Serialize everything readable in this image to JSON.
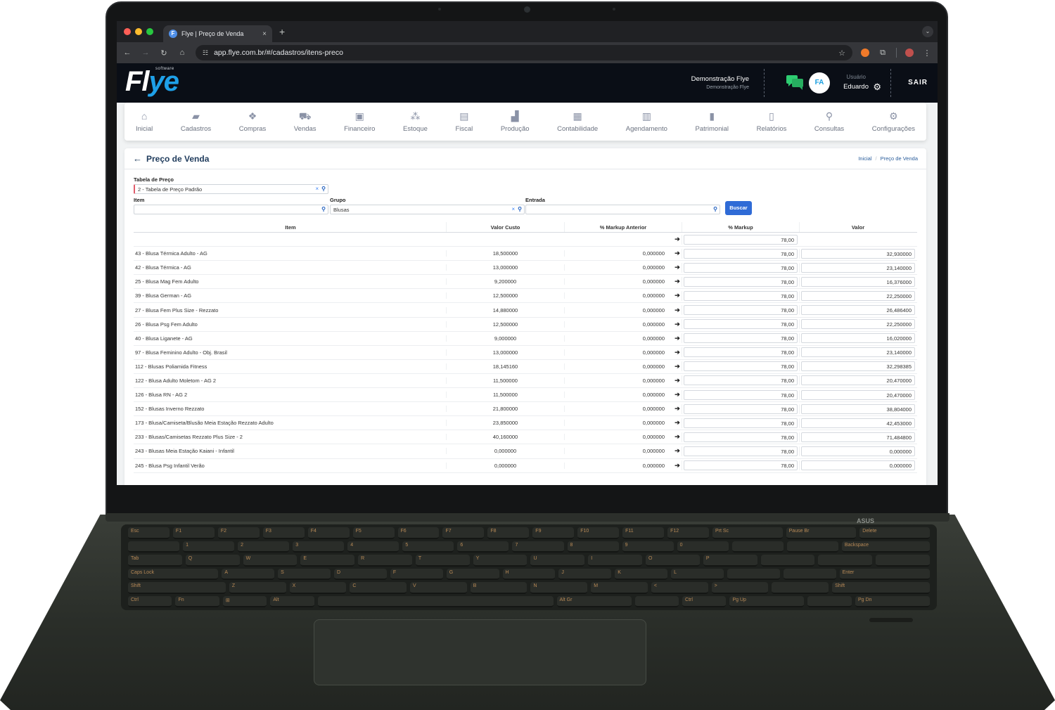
{
  "browser": {
    "tab_title": "Flye | Preço de Venda",
    "tab_favicon": "F",
    "tab_close": "×",
    "new_tab": "+",
    "url": "app.flye.com.br/#/cadastros/itens-preco"
  },
  "header": {
    "logo_main": "Fl",
    "logo_accent": "ye",
    "logo_sub": "software",
    "company_name": "Demonstração Flye",
    "company_sub": "Demonstração Flye",
    "avatar_initials": "FA",
    "user_label": "Usuário",
    "user_name": "Eduardo",
    "logout_label": "SAIR"
  },
  "nav": {
    "items": [
      {
        "label": "Inicial",
        "icon": "home-icon",
        "glyph": "⌂"
      },
      {
        "label": "Cadastros",
        "icon": "folder-open-icon",
        "glyph": "▰"
      },
      {
        "label": "Compras",
        "icon": "boxes-icon",
        "glyph": "❖"
      },
      {
        "label": "Vendas",
        "icon": "cart-icon",
        "glyph": "⛟"
      },
      {
        "label": "Financeiro",
        "icon": "money-bill-icon",
        "glyph": "▣"
      },
      {
        "label": "Estoque",
        "icon": "cubes-icon",
        "glyph": "⁂"
      },
      {
        "label": "Fiscal",
        "icon": "book-icon",
        "glyph": "▤"
      },
      {
        "label": "Produção",
        "icon": "industry-icon",
        "glyph": "▟"
      },
      {
        "label": "Contabilidade",
        "icon": "calculator-icon",
        "glyph": "▦"
      },
      {
        "label": "Agendamento",
        "icon": "calendar-icon",
        "glyph": "▥"
      },
      {
        "label": "Patrimonial",
        "icon": "building-icon",
        "glyph": "▮"
      },
      {
        "label": "Relatórios",
        "icon": "file-icon",
        "glyph": "▯"
      },
      {
        "label": "Consultas",
        "icon": "search-icon",
        "glyph": "⚲"
      },
      {
        "label": "Configurações",
        "icon": "cog-icon",
        "glyph": "⚙"
      }
    ]
  },
  "page": {
    "title": "Preço de Venda",
    "breadcrumb": [
      "Inicial",
      "/",
      "Preço de Venda"
    ]
  },
  "form": {
    "tabela_label": "Tabela de Preço",
    "tabela_value": "2 - Tabela de Preço Padrão",
    "item_label": "Item",
    "item_value": "",
    "grupo_label": "Grupo",
    "grupo_value": "Blusas",
    "entrada_label": "Entrada",
    "entrada_value": "",
    "buscar_label": "Buscar",
    "clear_glyph": "×",
    "search_glyph": "⚲"
  },
  "table": {
    "columns": [
      "Item",
      "Valor Custo",
      "% Markup Anterior",
      "% Markup",
      "Valor"
    ],
    "apply_all_markup": "78,00",
    "rows": [
      {
        "item": "43 - Blusa Térmica Adulto - AG",
        "custo": "18,500000",
        "anterior": "0,000000",
        "markup": "78,00",
        "valor": "32,930000"
      },
      {
        "item": "42 - Blusa Térmica - AG",
        "custo": "13,000000",
        "anterior": "0,000000",
        "markup": "78,00",
        "valor": "23,140000"
      },
      {
        "item": "25 - Blusa Mag Fem Adulto",
        "custo": "9,200000",
        "anterior": "0,000000",
        "markup": "78,00",
        "valor": "16,376000"
      },
      {
        "item": "39 - Blusa German - AG",
        "custo": "12,500000",
        "anterior": "0,000000",
        "markup": "78,00",
        "valor": "22,250000"
      },
      {
        "item": "27 - Blusa Fem Plus Size - Rezzato",
        "custo": "14,880000",
        "anterior": "0,000000",
        "markup": "78,00",
        "valor": "26,486400"
      },
      {
        "item": "26 - Blusa Psg Fem Adulto",
        "custo": "12,500000",
        "anterior": "0,000000",
        "markup": "78,00",
        "valor": "22,250000"
      },
      {
        "item": "40 - Blusa Liganete - AG",
        "custo": "9,000000",
        "anterior": "0,000000",
        "markup": "78,00",
        "valor": "16,020000"
      },
      {
        "item": "97 - Blusa Feminino Adulto - Obj. Brasil",
        "custo": "13,000000",
        "anterior": "0,000000",
        "markup": "78,00",
        "valor": "23,140000"
      },
      {
        "item": "112 - Blusas Poliamida Fitness",
        "custo": "18,145160",
        "anterior": "0,000000",
        "markup": "78,00",
        "valor": "32,298385"
      },
      {
        "item": "122 - Blusa Adulto Moletom - AG 2",
        "custo": "11,500000",
        "anterior": "0,000000",
        "markup": "78,00",
        "valor": "20,470000"
      },
      {
        "item": "126 - Blusa RN - AG 2",
        "custo": "11,500000",
        "anterior": "0,000000",
        "markup": "78,00",
        "valor": "20,470000"
      },
      {
        "item": "152 - Blusas Inverno Rezzato",
        "custo": "21,800000",
        "anterior": "0,000000",
        "markup": "78,00",
        "valor": "38,804000"
      },
      {
        "item": "173 - Blusa/Camiseta/Blusão Meia Estação Rezzato Adulto",
        "custo": "23,850000",
        "anterior": "0,000000",
        "markup": "78,00",
        "valor": "42,453000"
      },
      {
        "item": "233 - Blusas/Camisetas Rezzato Plus Size - 2",
        "custo": "40,160000",
        "anterior": "0,000000",
        "markup": "78,00",
        "valor": "71,484800"
      },
      {
        "item": "243 - Blusas Meia Estação Kaiani - Infantil",
        "custo": "0,000000",
        "anterior": "0,000000",
        "markup": "78,00",
        "valor": "0,000000"
      },
      {
        "item": "245 - Blusa Psg Infantil Verão",
        "custo": "0,000000",
        "anterior": "0,000000",
        "markup": "78,00",
        "valor": "0,000000"
      }
    ]
  },
  "keyboard": {
    "brand": "ASUS",
    "rows": [
      [
        "Esc",
        "F1",
        "F2",
        "F3",
        "F4",
        "F5",
        "F6",
        "F7",
        "F8",
        "F9",
        "F10",
        "F11",
        "F12",
        "Prt Sc",
        "Pause Br",
        "Delete"
      ],
      [
        "",
        "1",
        "2",
        "3",
        "4",
        "5",
        "6",
        "7",
        "8",
        "9",
        "0",
        "",
        "",
        "Backspace"
      ],
      [
        "Tab",
        "Q",
        "W",
        "E",
        "R",
        "T",
        "Y",
        "U",
        "I",
        "O",
        "P",
        "",
        "",
        ""
      ],
      [
        "Caps Lock",
        "A",
        "S",
        "D",
        "F",
        "G",
        "H",
        "J",
        "K",
        "L",
        "",
        "",
        "Enter"
      ],
      [
        "Shift",
        "Z",
        "X",
        "C",
        "V",
        "B",
        "N",
        "M",
        "<",
        ">",
        "",
        "Shift"
      ],
      [
        "Ctrl",
        "Fn",
        "⊞",
        "Alt",
        "",
        "Alt Gr",
        "",
        "Ctrl",
        "Pg Up",
        "",
        "Pg Dn"
      ]
    ]
  },
  "colors": {
    "accent": "#2f6bd6",
    "header_bg": "#0a0e16",
    "logo_accent": "#1ea0e8",
    "chat_icon": "#2ecc71"
  }
}
